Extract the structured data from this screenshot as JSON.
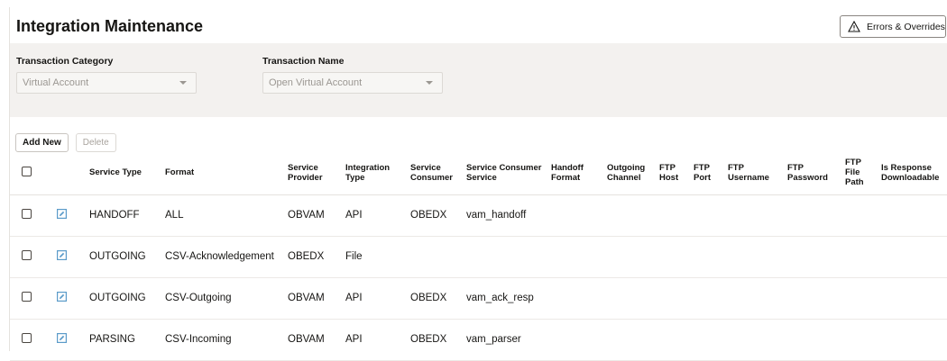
{
  "header": {
    "title": "Integration Maintenance",
    "errors_button": "Errors & Overrides"
  },
  "filters": {
    "category_label": "Transaction Category",
    "category_value": "Virtual Account",
    "name_label": "Transaction Name",
    "name_value": "Open Virtual Account"
  },
  "toolbar": {
    "add_label": "Add New",
    "delete_label": "Delete"
  },
  "table": {
    "columns": [
      "Service Type",
      "Format",
      "Service Provider",
      "Integration Type",
      "Service Consumer",
      "Service Consumer Service",
      "Handoff Format",
      "Outgoing Channel",
      "FTP Host",
      "FTP Port",
      "FTP Username",
      "FTP Password",
      "FTP File Path",
      "Is Response Downloadable"
    ],
    "rows": [
      {
        "service_type": "HANDOFF",
        "format": "ALL",
        "provider": "OBVAM",
        "integration": "API",
        "consumer": "OBEDX",
        "consumer_service": "vam_handoff"
      },
      {
        "service_type": "OUTGOING",
        "format": "CSV-Acknowledgement",
        "provider": "OBEDX",
        "integration": "File",
        "consumer": "",
        "consumer_service": ""
      },
      {
        "service_type": "OUTGOING",
        "format": "CSV-Outgoing",
        "provider": "OBVAM",
        "integration": "API",
        "consumer": "OBEDX",
        "consumer_service": "vam_ack_resp"
      },
      {
        "service_type": "PARSING",
        "format": "CSV-Incoming",
        "provider": "OBVAM",
        "integration": "API",
        "consumer": "OBEDX",
        "consumer_service": "vam_parser"
      }
    ]
  },
  "colors": {
    "edit_icon": "#5b9bc9",
    "panel_bg": "#f3f1ef"
  },
  "icons": {
    "errors": "warning-triangle-icon",
    "edit": "edit-pencil-icon",
    "dropdown": "chevron-down-icon"
  }
}
